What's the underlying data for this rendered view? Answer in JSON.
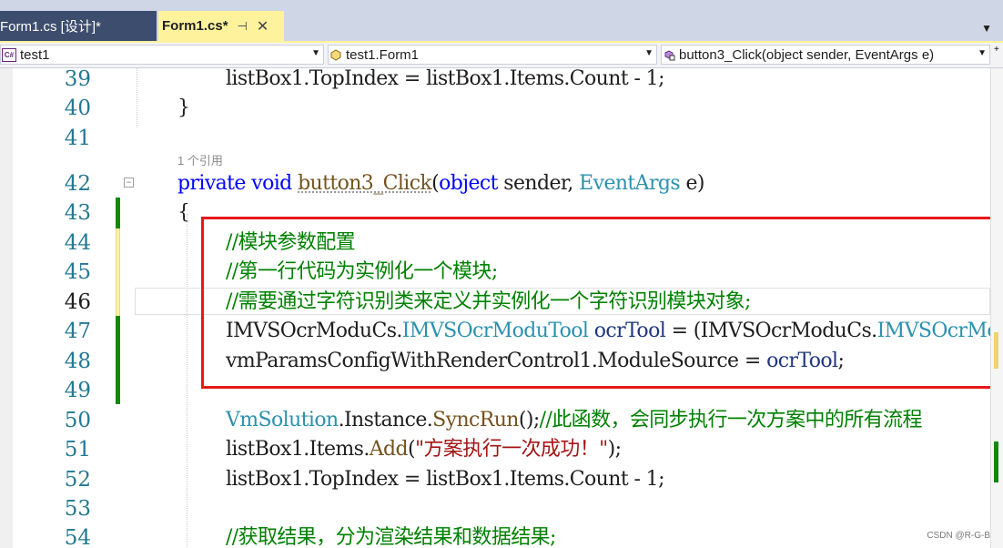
{
  "tabs": [
    {
      "label": "Form1.cs [设计]*",
      "active": false
    },
    {
      "label": "Form1.cs*",
      "active": true,
      "pin_icon": "pin-icon",
      "close_icon": "close-icon"
    }
  ],
  "navbar": {
    "project": "test1",
    "project_icon_text": "C#",
    "class": "test1.Form1",
    "member": "button3_Click(object sender, EventArgs e)"
  },
  "codelens": "1 个引用",
  "lines": [
    {
      "n": "39",
      "code": "listBox1.TopIndex = listBox1.Items.Count - 1;"
    },
    {
      "n": "40",
      "code": "}"
    },
    {
      "n": "41",
      "code": ""
    },
    {
      "n": "42",
      "code": "private void button3_Click(object sender, EventArgs e)"
    },
    {
      "n": "43",
      "code": "{"
    },
    {
      "n": "44",
      "code": "//模块参数配置"
    },
    {
      "n": "45",
      "code": "//第一行代码为实例化一个模块;"
    },
    {
      "n": "46",
      "code": "//需要通过字符识别类来定义并实例化一个字符识别模块对象;"
    },
    {
      "n": "47",
      "code": "IMVSOcrModuCs.IMVSOcrModuTool ocrTool = (IMVSOcrModuCs.IMVSOcrModuTool)"
    },
    {
      "n": "48",
      "code": "vmParamsConfigWithRenderControl1.ModuleSource = ocrTool;"
    },
    {
      "n": "49",
      "code": ""
    },
    {
      "n": "50",
      "code": "VmSolution.Instance.SyncRun();//此函数，会同步执行一次方案中的所有流程"
    },
    {
      "n": "51",
      "code": "listBox1.Items.Add(\"方案执行一次成功！\");"
    },
    {
      "n": "52",
      "code": "listBox1.TopIndex = listBox1.Items.Count - 1;"
    },
    {
      "n": "53",
      "code": ""
    },
    {
      "n": "54",
      "code": "//获取结果，分为渲染结果和数据结果;"
    }
  ],
  "current_line": "46",
  "watermark": "CSDN @R-G-B",
  "colors": {
    "keyword": "#0000ff",
    "type": "#2b91af",
    "comment": "#008000",
    "string": "#a31515",
    "highlight_box": "#e81818"
  }
}
